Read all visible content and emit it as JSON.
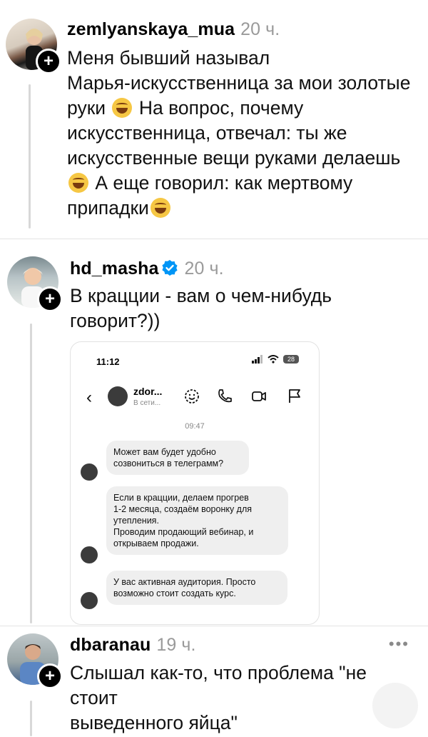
{
  "posts": [
    {
      "username": "zemlyanskaya_mua",
      "time": "20 ч.",
      "lines": [
        "Меня бывший называл",
        "Марья-искусственница за мои золотые",
        "руки",
        "На вопрос, почему",
        "искусственница, отвечал: ты же",
        "искусственные вещи руками делаешь",
        "А еще говорил: как мертвому",
        "припадки"
      ],
      "avatar_icon": "user-avatar",
      "follow_icon": "plus-icon"
    },
    {
      "username": "hd_masha",
      "time": "20 ч.",
      "verified_icon": "verified-badge-icon",
      "lines": [
        "В крацции - вам о чем-нибудь",
        "говорит?))"
      ],
      "embed": {
        "status_time": "11:12",
        "battery": "28",
        "chat_name": "zdor...",
        "chat_status": "В сети...",
        "timestamp": "09:47",
        "messages": [
          [
            "Может вам будет удобно",
            "созвониться в телеграмм?"
          ],
          [
            "Если в крацции, делаем прогрев",
            "1-2 месяца, создаём воронку для",
            "утепления.",
            "Проводим продающий вебинар, и",
            "открываем продажи."
          ],
          [
            "У вас активная аудитория. Просто",
            "возможно стоит создать курс."
          ]
        ]
      }
    },
    {
      "username": "dbaranau",
      "time": "19 ч.",
      "more": "•••",
      "lines": [
        "Слышал как-то, что проблема \"не стоит",
        "выведенного яйца\""
      ]
    }
  ],
  "colors": {
    "verified": "#0095f6",
    "muted": "#9a9a9a",
    "bubble": "#efefef"
  }
}
